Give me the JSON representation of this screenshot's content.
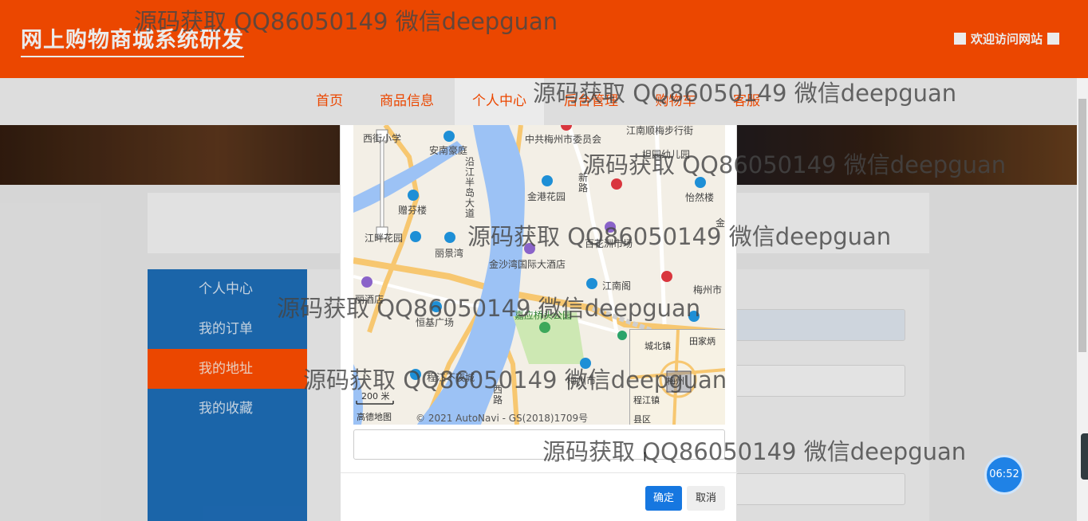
{
  "header": {
    "site_title": "网上购物商城系统研发",
    "welcome_text": "欢迎访问网站"
  },
  "nav": {
    "items": [
      "首页",
      "商品信息",
      "个人中心",
      "后台管理",
      "购物车",
      "客服"
    ],
    "active_index": 2
  },
  "sidebar": {
    "items": [
      "个人中心",
      "我的订单",
      "我的地址",
      "我的收藏"
    ],
    "active_index": 2
  },
  "map": {
    "labels": [
      "西街小学",
      "中共梅州市委员会",
      "江南顺梅步行街",
      "安南豪庭",
      "沿江半岛大道",
      "金港花园",
      "新路",
      "怡然楼",
      "赠芬楼",
      "江畔花园",
      "丽景湾",
      "百花洲市场",
      "金沙湾国际大酒店",
      "江南阁",
      "梅州市",
      "丽酒店",
      "恒基广场",
      "嘉应桥头公园",
      "程江不夜城",
      "梅州市",
      "西路",
      "金",
      "坦园幼儿园"
    ],
    "scale": "200 米",
    "logo": "高德地图",
    "attribution": "© 2021 AutoNavi - GS(2018)1709号",
    "inset_labels": [
      "城北镇",
      "田家炳",
      "程江镇",
      "梅州",
      "县区"
    ]
  },
  "modal": {
    "address_value": "",
    "confirm_label": "确定",
    "cancel_label": "取消"
  },
  "timer": "06:52",
  "watermark": "源码获取 QQ86050149 微信deepguan",
  "colors": {
    "header_bg": "#ff4e00",
    "sidebar_bg": "#1e6eb8",
    "confirm_btn": "#1677e0",
    "timer_bg": "#1f82e6"
  }
}
